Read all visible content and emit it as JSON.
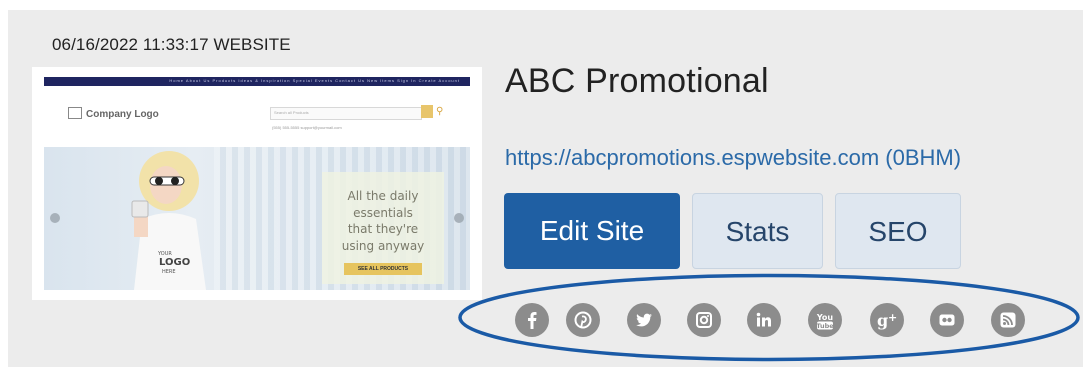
{
  "card": {
    "timestamp": "06/16/2022 11:33:17 WEBSITE"
  },
  "preview": {
    "nav_links": "Home  About Us  Products  Ideas & Inspiration  Special Events  Contact Us  New Items  Sign In  Create Account",
    "logo_text": "Company Logo",
    "search_placeholder": "Search all Products",
    "contact_text": "(555) 555-5555   support@yourmail.com",
    "hero_lines": [
      "All the daily",
      "essentials",
      "that they're",
      "using anyway"
    ],
    "cta_label": "SEE ALL PRODUCTS"
  },
  "site": {
    "title": "ABC Promotional",
    "url": "https://abcpromotions.espwebsite.com (0BHM)"
  },
  "actions": {
    "edit_label": "Edit Site",
    "stats_label": "Stats",
    "seo_label": "SEO"
  },
  "social": [
    {
      "name": "facebook-icon",
      "glyph": "f"
    },
    {
      "name": "pinterest-icon",
      "glyph": "p"
    },
    {
      "name": "twitter-icon",
      "glyph": "t"
    },
    {
      "name": "instagram-icon",
      "glyph": "i"
    },
    {
      "name": "linkedin-icon",
      "glyph": "in"
    },
    {
      "name": "youtube-icon",
      "glyph": "You"
    },
    {
      "name": "google-plus-icon",
      "glyph": "g+"
    },
    {
      "name": "flickr-icon",
      "glyph": "••"
    },
    {
      "name": "rss-icon",
      "glyph": "rss"
    }
  ],
  "colors": {
    "card_bg": "#ececec",
    "primary": "#1f5fa3",
    "secondary_bg": "#dfe7f0",
    "link": "#2b6aa8",
    "social_icon": "#8c8c8c",
    "annotation": "#1a5aa6"
  }
}
